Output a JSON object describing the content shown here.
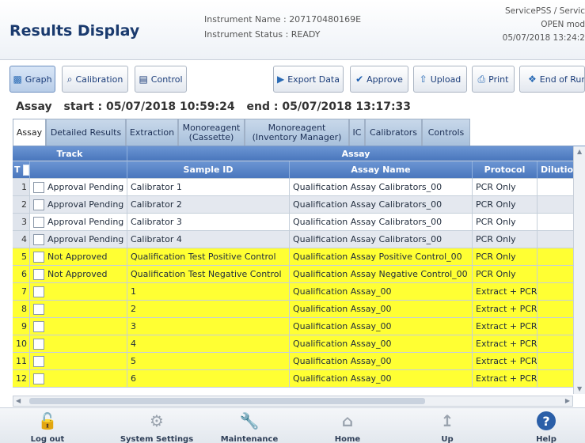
{
  "header": {
    "title": "Results Display",
    "instrument_name_label": "Instrument Name :",
    "instrument_name": "207170480169E",
    "instrument_status_label": "Instrument Status :",
    "instrument_status": "READY",
    "user": "ServicePSS / Servic",
    "mode": "OPEN mod",
    "datetime": "05/07/2018 13:24:2"
  },
  "toolbar": {
    "graph": "Graph",
    "calibration": "Calibration",
    "control": "Control",
    "export_data": "Export Data",
    "approve": "Approve",
    "upload": "Upload",
    "print": "Print",
    "end_of_run": "End of Run"
  },
  "assay_line": {
    "label": "Assay",
    "start_label": "start :",
    "start": "05/07/2018 10:59:24",
    "end_label": "end :",
    "end": "05/07/2018 13:17:33"
  },
  "tabs": [
    {
      "label": "Assay",
      "active": true
    },
    {
      "label": "Detailed Results"
    },
    {
      "label": "Extraction"
    },
    {
      "label": "Monoreagent (Cassette)"
    },
    {
      "label": "Monoreagent (Inventory Manager)"
    },
    {
      "label": "IC"
    },
    {
      "label": "Calibrators"
    },
    {
      "label": "Controls"
    }
  ],
  "table": {
    "group_headers": {
      "track": "Track",
      "assay": "Assay"
    },
    "columns": {
      "t": "T",
      "sample_id": "Sample ID",
      "assay_name": "Assay Name",
      "protocol": "Protocol",
      "dilution": "Dilution"
    },
    "rows": [
      {
        "idx": "1",
        "track": "Approval Pending",
        "sample": "Calibrator 1",
        "assay": "Qualification Assay Calibrators_00",
        "protocol": "PCR Only",
        "style": "white"
      },
      {
        "idx": "2",
        "track": "Approval Pending",
        "sample": "Calibrator 2",
        "assay": "Qualification Assay Calibrators_00",
        "protocol": "PCR Only",
        "style": "grey"
      },
      {
        "idx": "3",
        "track": "Approval Pending",
        "sample": "Calibrator 3",
        "assay": "Qualification Assay Calibrators_00",
        "protocol": "PCR Only",
        "style": "white"
      },
      {
        "idx": "4",
        "track": "Approval Pending",
        "sample": "Calibrator 4",
        "assay": "Qualification Assay Calibrators_00",
        "protocol": "PCR Only",
        "style": "grey"
      },
      {
        "idx": "5",
        "track": "Not Approved",
        "sample": "Qualification Test Positive Control",
        "assay": "Qualification Assay Positive Control_00",
        "protocol": "PCR Only",
        "style": "yellow"
      },
      {
        "idx": "6",
        "track": "Not Approved",
        "sample": "Qualification Test Negative Control",
        "assay": "Qualification Assay Negative Control_00",
        "protocol": "PCR Only",
        "style": "yellow"
      },
      {
        "idx": "7",
        "track": "",
        "sample": "1",
        "assay": "Qualification Assay_00",
        "protocol": "Extract + PCR",
        "style": "yellow"
      },
      {
        "idx": "8",
        "track": "",
        "sample": "2",
        "assay": "Qualification Assay_00",
        "protocol": "Extract + PCR",
        "style": "yellow"
      },
      {
        "idx": "9",
        "track": "",
        "sample": "3",
        "assay": "Qualification Assay_00",
        "protocol": "Extract + PCR",
        "style": "yellow"
      },
      {
        "idx": "10",
        "track": "",
        "sample": "4",
        "assay": "Qualification Assay_00",
        "protocol": "Extract + PCR",
        "style": "yellow"
      },
      {
        "idx": "11",
        "track": "",
        "sample": "5",
        "assay": "Qualification Assay_00",
        "protocol": "Extract + PCR",
        "style": "yellow"
      },
      {
        "idx": "12",
        "track": "",
        "sample": "6",
        "assay": "Qualification Assay_00",
        "protocol": "Extract + PCR",
        "style": "yellow"
      }
    ]
  },
  "bottom_nav": {
    "logout": "Log out",
    "system_settings": "System Settings",
    "maintenance": "Maintenance",
    "home": "Home",
    "up": "Up",
    "help": "Help"
  }
}
